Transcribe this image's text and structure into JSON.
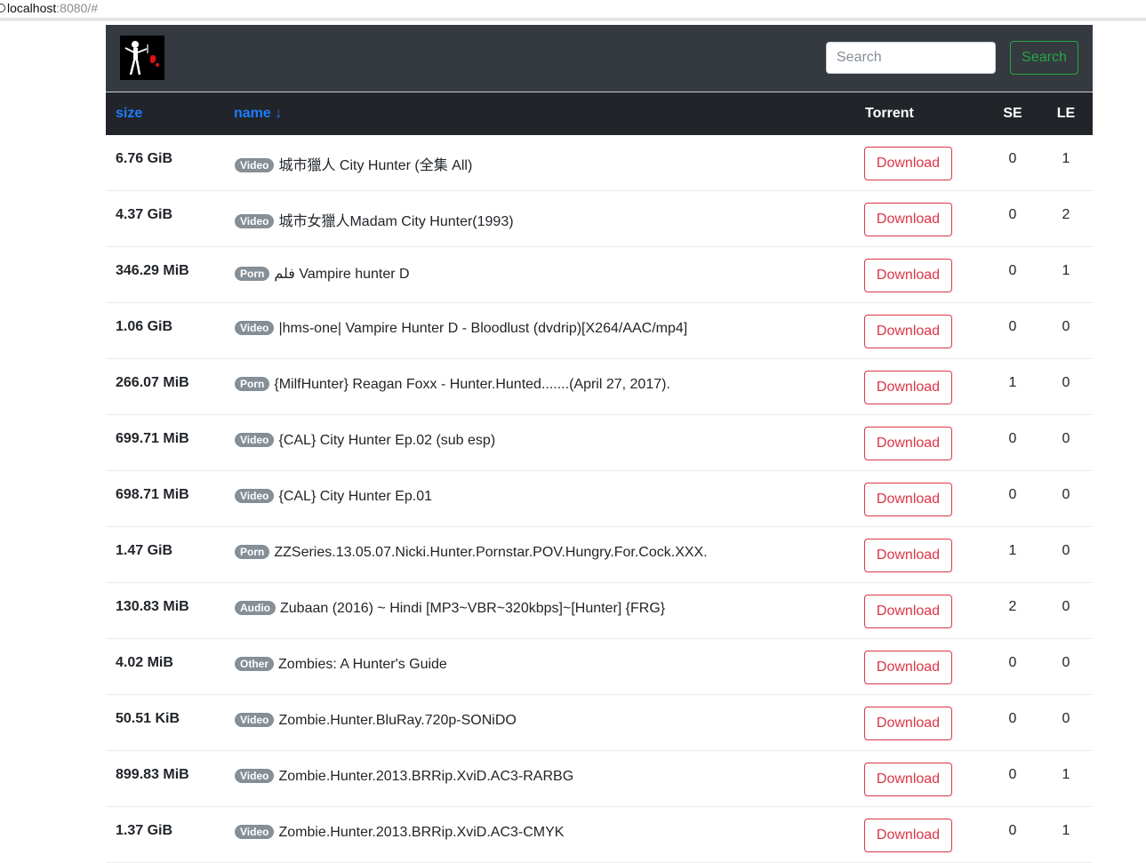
{
  "browser": {
    "host": "localhost",
    "rest": ":8080/#"
  },
  "navbar": {
    "logo_icon": "pirate-flag-logo",
    "search_placeholder": "Search",
    "search_button": "Search"
  },
  "table": {
    "columns": {
      "size": "size",
      "name": "name ↓",
      "torrent": "Torrent",
      "se": "SE",
      "le": "LE"
    },
    "download_label": "Download",
    "rows": [
      {
        "size": "6.76 GiB",
        "category": "Video",
        "name": "城市獵人 City Hunter (全集 All)",
        "se": "0",
        "le": "1"
      },
      {
        "size": "4.37 GiB",
        "category": "Video",
        "name": "城市女獵人Madam City Hunter(1993)",
        "se": "0",
        "le": "2"
      },
      {
        "size": "346.29 MiB",
        "category": "Porn",
        "name": "فلم Vampire hunter D",
        "se": "0",
        "le": "1"
      },
      {
        "size": "1.06 GiB",
        "category": "Video",
        "name": "|hms-one| Vampire Hunter D - Bloodlust (dvdrip)[X264/AAC/mp4]",
        "se": "0",
        "le": "0"
      },
      {
        "size": "266.07 MiB",
        "category": "Porn",
        "name": "{MilfHunter} Reagan Foxx - Hunter.Hunted.......(April 27, 2017).",
        "se": "1",
        "le": "0"
      },
      {
        "size": "699.71 MiB",
        "category": "Video",
        "name": "{CAL} City Hunter Ep.02 (sub esp)",
        "se": "0",
        "le": "0"
      },
      {
        "size": "698.71 MiB",
        "category": "Video",
        "name": "{CAL} City Hunter Ep.01",
        "se": "0",
        "le": "0"
      },
      {
        "size": "1.47 GiB",
        "category": "Porn",
        "name": "ZZSeries.13.05.07.Nicki.Hunter.Pornstar.POV.Hungry.For.Cock.XXX.",
        "se": "1",
        "le": "0"
      },
      {
        "size": "130.83 MiB",
        "category": "Audio",
        "name": "Zubaan (2016) ~ Hindi [MP3~VBR~320kbps]~[Hunter] {FRG}",
        "se": "2",
        "le": "0"
      },
      {
        "size": "4.02 MiB",
        "category": "Other",
        "name": "Zombies: A Hunter's Guide",
        "se": "0",
        "le": "0"
      },
      {
        "size": "50.51 KiB",
        "category": "Video",
        "name": "Zombie.Hunter.BluRay.720p-SONiDO",
        "se": "0",
        "le": "0"
      },
      {
        "size": "899.83 MiB",
        "category": "Video",
        "name": "Zombie.Hunter.2013.BRRip.XviD.AC3-RARBG",
        "se": "0",
        "le": "1"
      },
      {
        "size": "1.37 GiB",
        "category": "Video",
        "name": "Zombie.Hunter.2013.BRRip.XviD.AC3-CMYK",
        "se": "0",
        "le": "1"
      }
    ]
  }
}
